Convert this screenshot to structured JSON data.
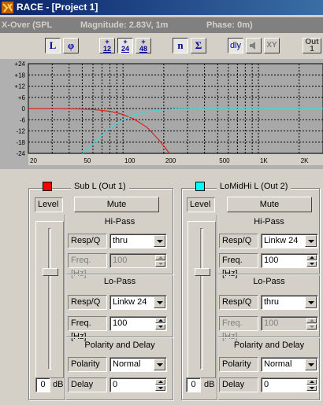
{
  "window": {
    "title": "RACE - [Project 1]"
  },
  "infobar": {
    "name": "X-Over (SPL",
    "magnitude": "Magnitude: 2.83V, 1m",
    "phase": "Phase: 0m)"
  },
  "toolbar": {
    "L": "L",
    "phi": "φ",
    "b12_top": "+",
    "b12_bot": "12",
    "b24_top": "+",
    "b24_bot": "24",
    "b48_top": "+",
    "b48_bot": "48",
    "n": "n",
    "sigma": "Σ",
    "dly": "dly",
    "xy": "XY",
    "out_top": "Out",
    "out_bot": "1"
  },
  "graph": {
    "y_ticks": [
      "+24",
      "+18",
      "+12",
      "+6",
      "0",
      "-6",
      "-12",
      "-18",
      "-24"
    ],
    "x_ticks": [
      "20",
      "50",
      "100",
      "200",
      "500",
      "1K",
      "2K"
    ],
    "colors": {
      "red": "#e02020",
      "cyan": "#40d8d8",
      "grid": "#000000"
    }
  },
  "chart_data": {
    "type": "line",
    "xscale": "log",
    "xlim": [
      20,
      3000
    ],
    "ylim": [
      -24,
      24
    ],
    "yticks": [
      24,
      18,
      12,
      6,
      0,
      -6,
      -12,
      -18,
      -24
    ],
    "xticks": [
      20,
      50,
      100,
      200,
      500,
      1000,
      2000
    ],
    "grid": true,
    "series": [
      {
        "color": "#e02020",
        "x": [
          20,
          40,
          60,
          80,
          90,
          100,
          120,
          150,
          180,
          200,
          220
        ],
        "y": [
          0,
          -0.1,
          -0.5,
          -1.5,
          -2.3,
          -3.2,
          -5.6,
          -10,
          -16,
          -20,
          -24
        ]
      },
      {
        "color": "#40d8d8",
        "x": [
          50,
          60,
          80,
          100,
          120,
          150,
          200,
          250,
          300,
          500,
          1000,
          3000
        ],
        "y": [
          -24,
          -19,
          -10.5,
          -6,
          -3.5,
          -1.6,
          -0.6,
          -0.2,
          -0.1,
          0,
          0,
          0
        ]
      }
    ]
  },
  "left": {
    "title": "Sub L (Out 1)",
    "color": "#ff0000",
    "level_label": "Level",
    "mute_label": "Mute",
    "level_value": "0",
    "level_unit": "dB",
    "level_position": 0.7,
    "hipass_title": "Hi-Pass",
    "hp_resp_label": "Resp/Q",
    "hp_resp_value": "thru",
    "hp_freq_label": "Freq.[Hz]",
    "hp_freq_value": "100",
    "lopass_title": "Lo-Pass",
    "lp_resp_label": "Resp/Q",
    "lp_resp_value": "Linkw 24",
    "lp_freq_label": "Freq.[Hz]",
    "lp_freq_value": "100",
    "pd_title": "Polarity and Delay",
    "polarity_label": "Polarity",
    "polarity_value": "Normal",
    "delay_label": "Delay",
    "delay_value": "0"
  },
  "right": {
    "title": "LoMidHi L (Out 2)",
    "color": "#00ffff",
    "level_label": "Level",
    "mute_label": "Mute",
    "level_value": "0",
    "level_unit": "dB",
    "level_position": 0.7,
    "hipass_title": "Hi-Pass",
    "hp_resp_label": "Resp/Q",
    "hp_resp_value": "Linkw 24",
    "hp_freq_label": "Freq.[Hz]",
    "hp_freq_value": "100",
    "lopass_title": "Lo-Pass",
    "lp_resp_label": "Resp/Q",
    "lp_resp_value": "thru",
    "lp_freq_label": "Freq.[Hz]",
    "lp_freq_value": "100",
    "pd_title": "Polarity and Delay",
    "polarity_label": "Polarity",
    "polarity_value": "Normal",
    "delay_label": "Delay",
    "delay_value": "0"
  }
}
